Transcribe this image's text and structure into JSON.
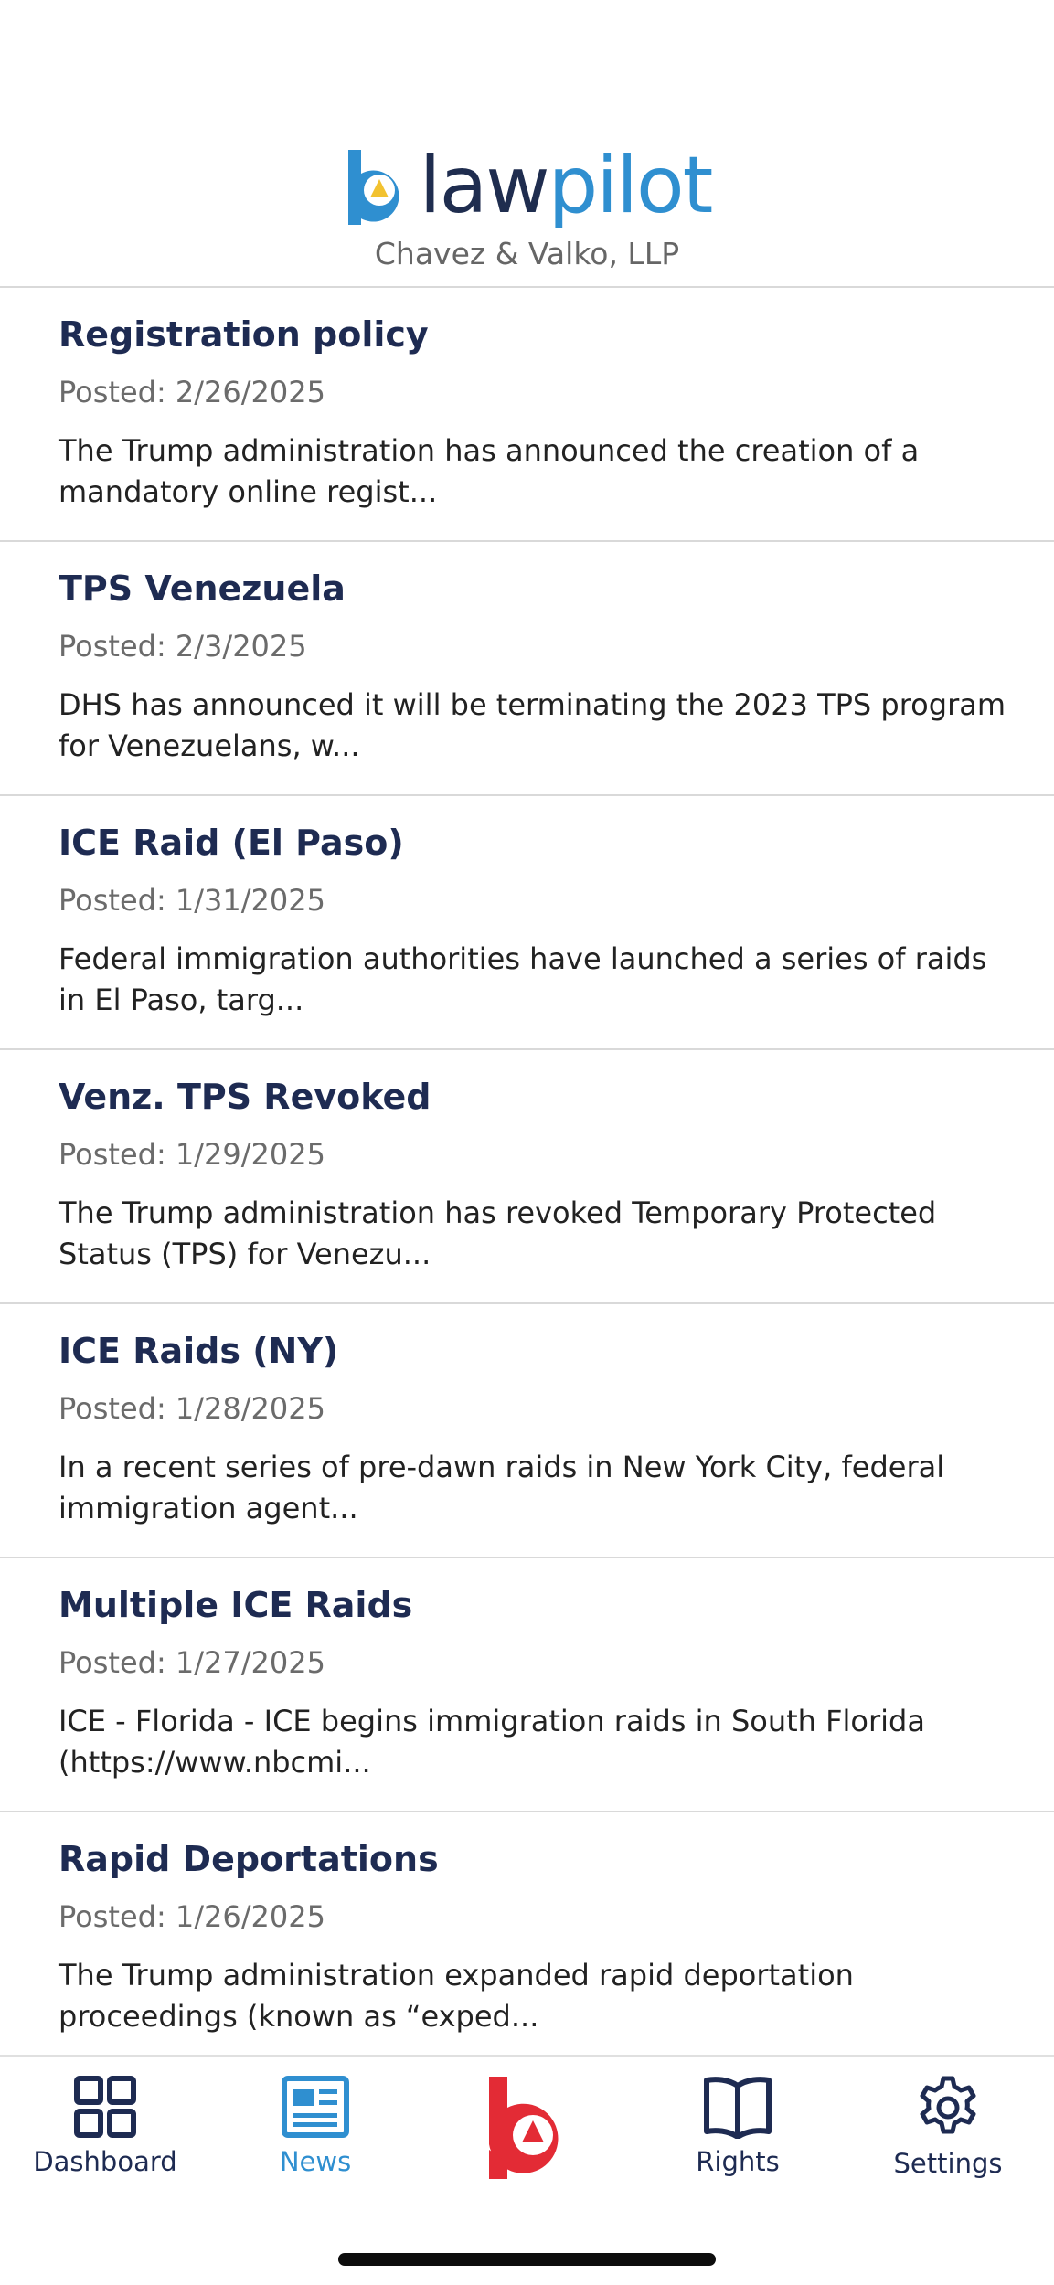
{
  "header": {
    "logo_law": "law",
    "logo_pilot": "pilot",
    "firm_name": "Chavez & Valko, LLP"
  },
  "news": [
    {
      "title": "Registration policy",
      "date": "Posted: 2/26/2025",
      "body": "The Trump administration has announced the creation of a mandatory online regist..."
    },
    {
      "title": "TPS Venezuela",
      "date": "Posted: 2/3/2025",
      "body": "DHS has announced it will be terminating the 2023 TPS program for Venezuelans, w..."
    },
    {
      "title": "ICE Raid (El Paso)",
      "date": "Posted: 1/31/2025",
      "body": "Federal immigration authorities have launched a series of raids in El Paso, targ..."
    },
    {
      "title": "Venz. TPS Revoked",
      "date": "Posted: 1/29/2025",
      "body": "The Trump administration has revoked Temporary Protected Status (TPS) for Venezu..."
    },
    {
      "title": "ICE Raids (NY)",
      "date": "Posted: 1/28/2025",
      "body": "In a recent series of pre-dawn raids in New York City, federal immigration agent..."
    },
    {
      "title": "Multiple ICE Raids",
      "date": "Posted: 1/27/2025",
      "body": "ICE - Florida - ICE begins immigration raids in South Florida (https://www.nbcmi..."
    },
    {
      "title": "Rapid Deportations",
      "date": "Posted: 1/26/2025",
      "body": "The Trump administration expanded rapid deportation proceedings (known as “exped..."
    }
  ],
  "tabbar": {
    "dashboard": "Dashboard",
    "news": "News",
    "rights": "Rights",
    "settings": "Settings",
    "active": "news",
    "accent_color": "#2f8fd0",
    "brand_color": "#e32b35",
    "icons": {
      "dashboard": "grid-icon",
      "news": "newspaper-icon",
      "center": "lawpilot-logo-icon",
      "rights": "book-icon",
      "settings": "gear-icon"
    }
  }
}
